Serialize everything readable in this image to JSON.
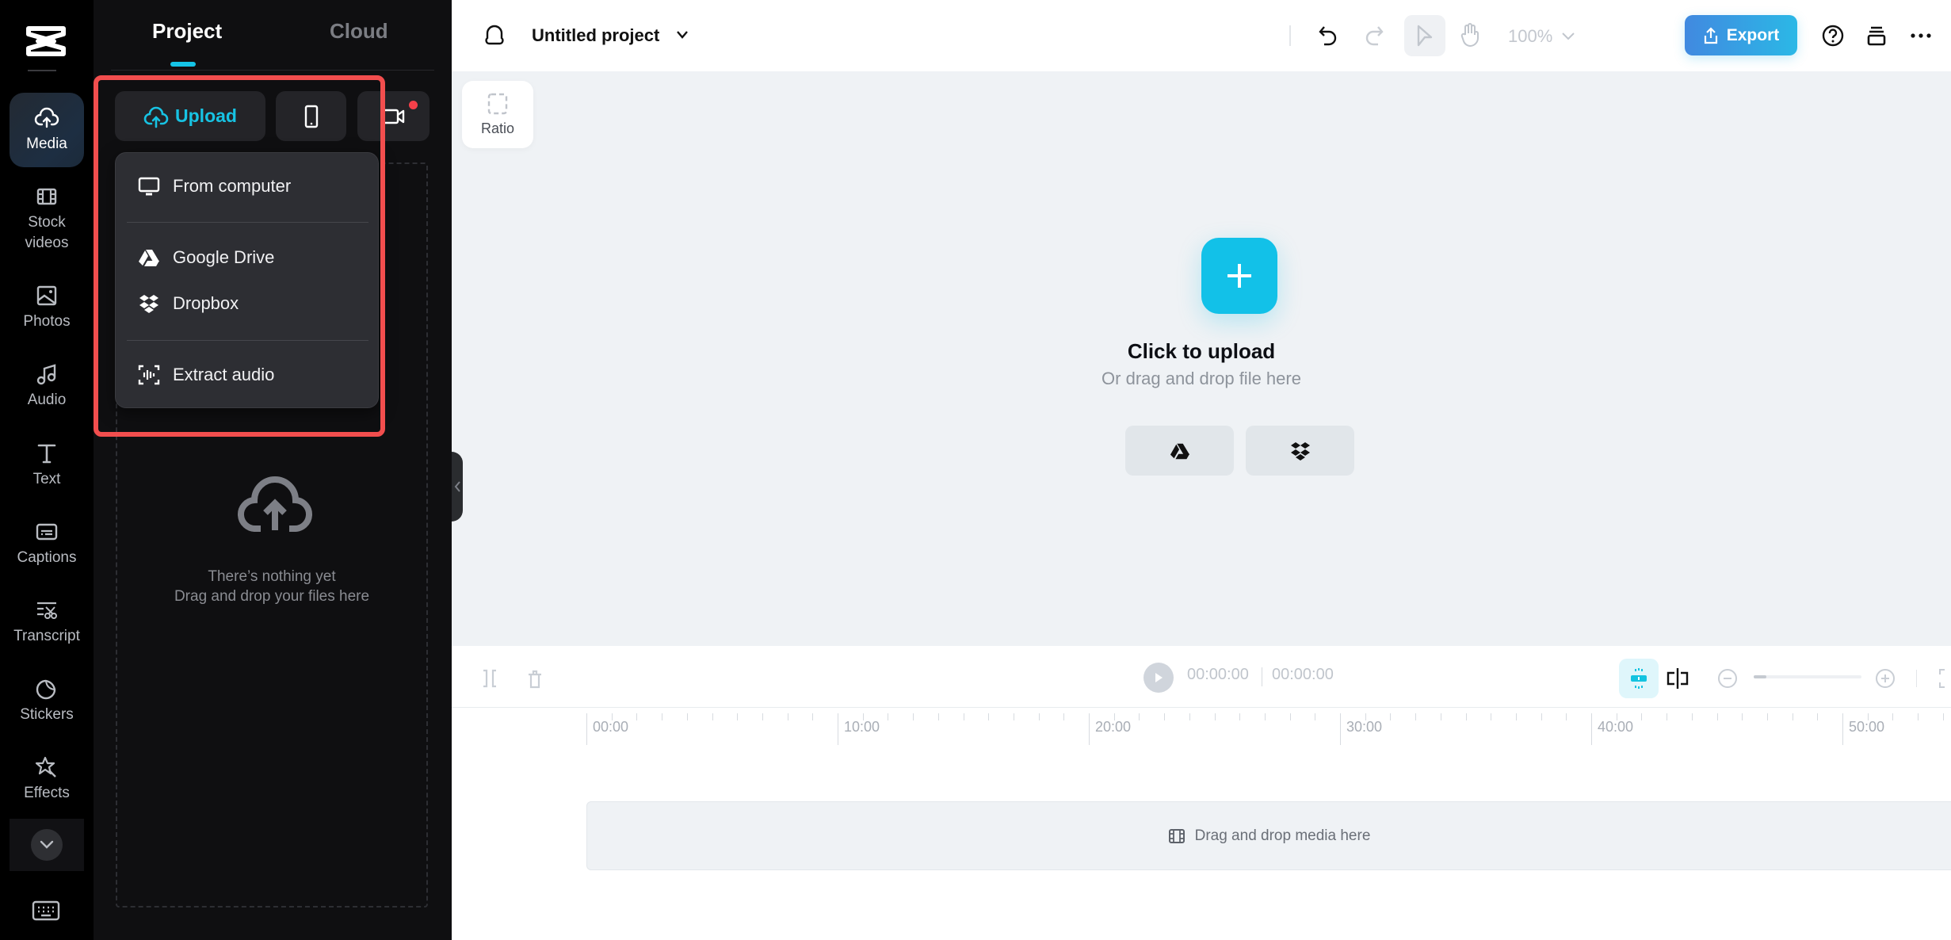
{
  "app": {
    "name": "CapCut"
  },
  "rail": {
    "items": [
      {
        "label": "Media",
        "icon": "cloud-upload-icon",
        "active": true
      },
      {
        "label": "Stock videos",
        "icon": "film-icon"
      },
      {
        "label": "Photos",
        "icon": "image-icon"
      },
      {
        "label": "Audio",
        "icon": "music-note-icon"
      },
      {
        "label": "Text",
        "icon": "text-icon"
      },
      {
        "label": "Captions",
        "icon": "captions-icon"
      },
      {
        "label": "Transcript",
        "icon": "transcript-icon"
      },
      {
        "label": "Stickers",
        "icon": "sticker-icon"
      },
      {
        "label": "Effects",
        "icon": "effects-star-icon"
      }
    ],
    "more_icon": "chevron-down-icon",
    "keyboard_icon": "keyboard-icon"
  },
  "panel": {
    "tabs": [
      {
        "label": "Project",
        "active": true
      },
      {
        "label": "Cloud",
        "active": false
      }
    ],
    "upload_label": "Upload",
    "phone_icon": "phone-icon",
    "record_icon": "video-camera-icon",
    "empty": {
      "line1": "There’s nothing yet",
      "line2": "Drag and drop your files here"
    }
  },
  "upload_menu": {
    "items": [
      {
        "label": "From computer",
        "icon": "monitor-icon"
      },
      {
        "label": "Google Drive",
        "icon": "google-drive-icon"
      },
      {
        "label": "Dropbox",
        "icon": "dropbox-icon"
      },
      {
        "label": "Extract audio",
        "icon": "extract-audio-icon"
      }
    ]
  },
  "topbar": {
    "project_title": "Untitled project",
    "zoom_level": "100%",
    "export_label": "Export"
  },
  "canvas": {
    "ratio_label": "Ratio",
    "upload_title": "Click to upload",
    "upload_subtitle": "Or drag and drop file here"
  },
  "timeline": {
    "current_time": "00:00:00",
    "total_time": "00:00:00",
    "zoom_fraction": 0.05,
    "ruler_labels": [
      "00:00",
      "10:00",
      "20:00",
      "30:00",
      "40:00",
      "50:00"
    ],
    "track_placeholder": "Drag and drop media here"
  },
  "colors": {
    "accent": "#15c3e6",
    "highlight": "#f24e4e",
    "export_gradient_start": "#4189e0",
    "export_gradient_end": "#2bb8e6"
  }
}
